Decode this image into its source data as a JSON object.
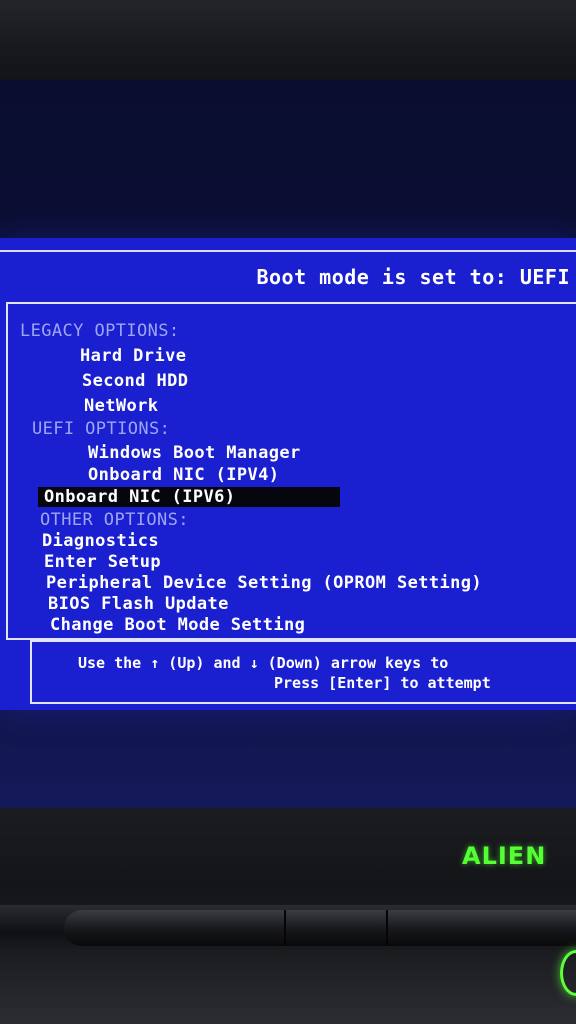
{
  "header": {
    "boot_mode": "Boot mode is set to: UEFI"
  },
  "menu": {
    "legacy_label": "LEGACY OPTIONS:",
    "legacy_items": [
      "Hard Drive",
      "Second HDD",
      "NetWork"
    ],
    "uefi_label": "UEFI OPTIONS:",
    "uefi_items": [
      "Windows Boot Manager",
      "Onboard NIC (IPV4)",
      "Onboard NIC (IPV6)"
    ],
    "other_label": "OTHER OPTIONS:",
    "other_items": [
      "Diagnostics",
      "Enter Setup",
      "Peripheral Device Setting (OPROM Setting)",
      "BIOS Flash Update",
      "Change Boot Mode Setting"
    ],
    "selected_item": "Onboard NIC (IPV6)"
  },
  "footer": {
    "line1": "Use the ↑ (Up) and ↓ (Down) arrow keys to",
    "line2": "Press [Enter] to attempt"
  },
  "device": {
    "logo_text": "ALIEN"
  },
  "colors": {
    "bios_blue": "#1a1fd0",
    "section_text": "#9ea6f4",
    "highlight_bg": "#06070e",
    "logo_green": "#54ff33"
  }
}
